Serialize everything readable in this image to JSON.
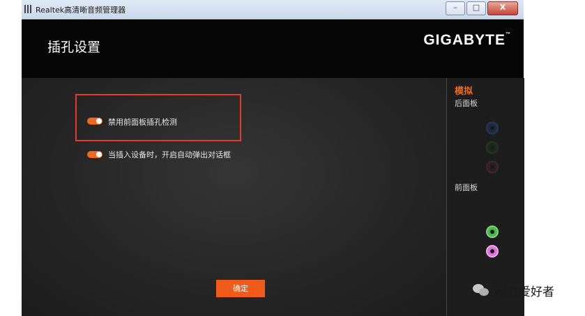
{
  "window": {
    "title": "Realtek高清晰音频管理器",
    "minimize_glyph": "–",
    "maximize_glyph": "□",
    "close_glyph": "X"
  },
  "header": {
    "title": "插孔设置",
    "brand": "GIGABYTE",
    "brand_mark": "™"
  },
  "options": [
    {
      "label": "禁用前面板插孔检测",
      "enabled": true
    },
    {
      "label": "当插入设备时，开启自动弹出对话框",
      "enabled": true
    }
  ],
  "ok_button": {
    "label": "确定"
  },
  "side_panel": {
    "title": "模拟",
    "rear_label": "后面板",
    "front_label": "前面板",
    "rear_jacks": [
      "blue-jack-icon",
      "green-jack-icon",
      "pink-jack-icon"
    ],
    "front_jacks": [
      "green-jack-icon",
      "pink-jack-icon"
    ]
  },
  "watermark": {
    "text": "网管爱好者"
  },
  "colors": {
    "accent": "#f06a1e",
    "highlight": "#e33b2c",
    "header_bg": "#050505"
  }
}
